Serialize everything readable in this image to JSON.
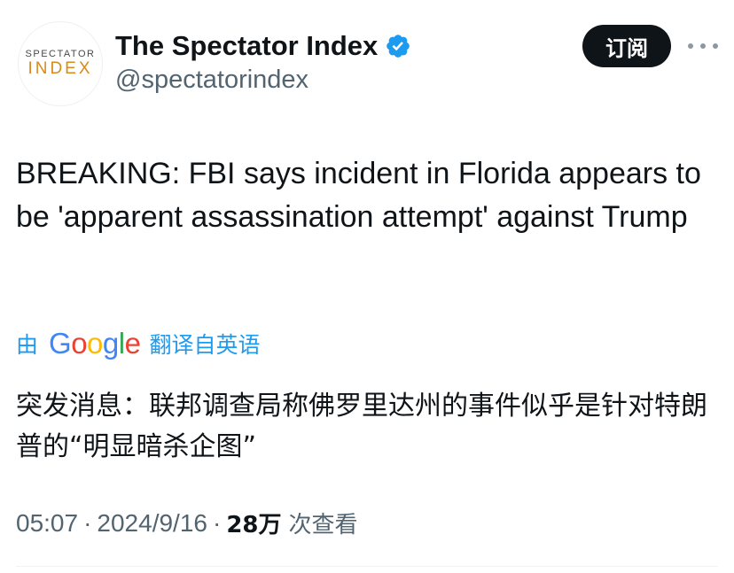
{
  "account": {
    "avatar_line1": "SPECTATOR",
    "avatar_line2": "INDEX",
    "display_name": "The Spectator Index",
    "handle": "@spectatorindex",
    "verified_icon": "verified-badge-icon",
    "verified_color": "#1d9bf0"
  },
  "header": {
    "subscribe_label": "订阅",
    "more_icon": "more-horizontal-icon"
  },
  "tweet": {
    "text": "BREAKING: FBI says incident in Florida appears to be 'apparent assassination attempt' against Trump",
    "translation_prefix": "由",
    "translation_provider": "Google",
    "translation_suffix": "翻译自英语",
    "translated_text": "突发消息：联邦调查局称佛罗里达州的事件似乎是针对特朗普的“明显暗杀企图”"
  },
  "meta": {
    "time": "05:07",
    "separator": "·",
    "date": "2024/9/16",
    "views_count": "28万",
    "views_label": "次查看"
  },
  "colors": {
    "link": "#1d9bf0",
    "secondary_text": "#536471",
    "button_bg": "#0f1419"
  }
}
